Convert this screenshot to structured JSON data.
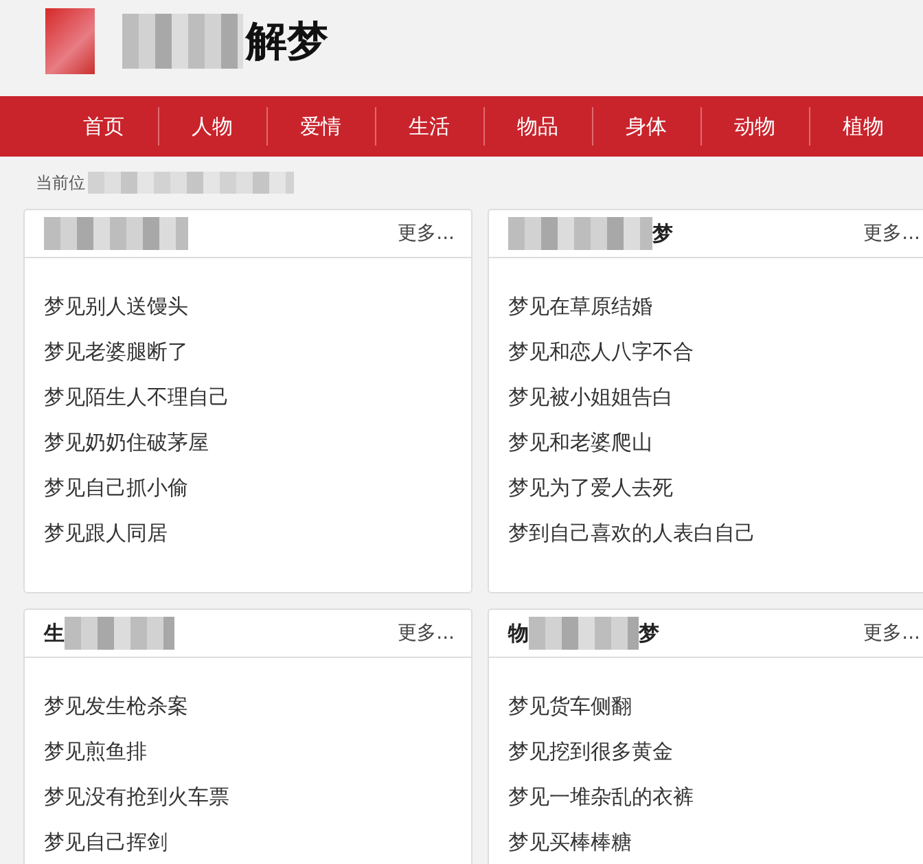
{
  "logo": {
    "text": "解梦"
  },
  "nav": [
    {
      "label": "首页"
    },
    {
      "label": "人物"
    },
    {
      "label": "爱情"
    },
    {
      "label": "生活"
    },
    {
      "label": "物品"
    },
    {
      "label": "身体"
    },
    {
      "label": "动物"
    },
    {
      "label": "植物"
    }
  ],
  "breadcrumb": {
    "label": "当前位"
  },
  "cards": [
    {
      "more": "更多...",
      "items": [
        "梦见别人送馒头",
        "梦见老婆腿断了",
        "梦见陌生人不理自己",
        "梦见奶奶住破茅屋",
        "梦见自己抓小偷",
        "梦见跟人同居"
      ]
    },
    {
      "title_suffix": "梦",
      "more": "更多...",
      "items": [
        "梦见在草原结婚",
        "梦见和恋人八字不合",
        "梦见被小姐姐告白",
        "梦见和老婆爬山",
        "梦见为了爱人去死",
        "梦到自己喜欢的人表白自己"
      ]
    },
    {
      "title_prefix": "生",
      "more": "更多...",
      "items": [
        "梦见发生枪杀案",
        "梦见煎鱼排",
        "梦见没有抢到火车票",
        "梦见自己挥剑"
      ]
    },
    {
      "title_prefix": "物",
      "title_suffix": "梦",
      "more": "更多...",
      "items": [
        "梦见货车侧翻",
        "梦见挖到很多黄金",
        "梦见一堆杂乱的衣裤",
        "梦见买棒棒糖"
      ]
    }
  ]
}
